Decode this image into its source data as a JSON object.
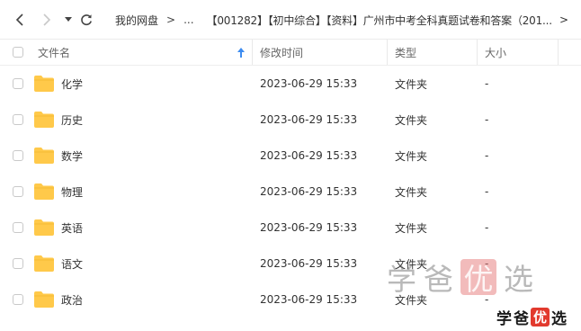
{
  "breadcrumb": {
    "root": "我的网盘",
    "sep": ">",
    "ellipsis": "...",
    "current": "【001282】【初中综合】【资料】广州市中考全科真题试卷和答案（201...",
    "more": ">"
  },
  "columns": {
    "name": "文件名",
    "modified": "修改时间",
    "type": "类型",
    "size": "大小"
  },
  "files": [
    {
      "name": "化学",
      "modified": "2023-06-29 15:33",
      "type": "文件夹",
      "size": "-"
    },
    {
      "name": "历史",
      "modified": "2023-06-29 15:33",
      "type": "文件夹",
      "size": "-"
    },
    {
      "name": "数学",
      "modified": "2023-06-29 15:33",
      "type": "文件夹",
      "size": "-"
    },
    {
      "name": "物理",
      "modified": "2023-06-29 15:33",
      "type": "文件夹",
      "size": "-"
    },
    {
      "name": "英语",
      "modified": "2023-06-29 15:33",
      "type": "文件夹",
      "size": "-"
    },
    {
      "name": "语文",
      "modified": "2023-06-29 15:33",
      "type": "文件夹",
      "size": "-"
    },
    {
      "name": "政治",
      "modified": "2023-06-29 15:33",
      "type": "文件夹",
      "size": "-"
    }
  ],
  "watermark": {
    "c1": "学",
    "c2": "爸",
    "c3": "优",
    "c4": "选"
  },
  "colors": {
    "folder": "#ffc94a",
    "sort_arrow": "#3d8cf0",
    "logo_red": "#e23a2e"
  },
  "icons": [
    "back-arrow-icon",
    "forward-arrow-icon",
    "dropdown-icon",
    "refresh-icon",
    "sort-asc-icon",
    "folder-icon"
  ]
}
